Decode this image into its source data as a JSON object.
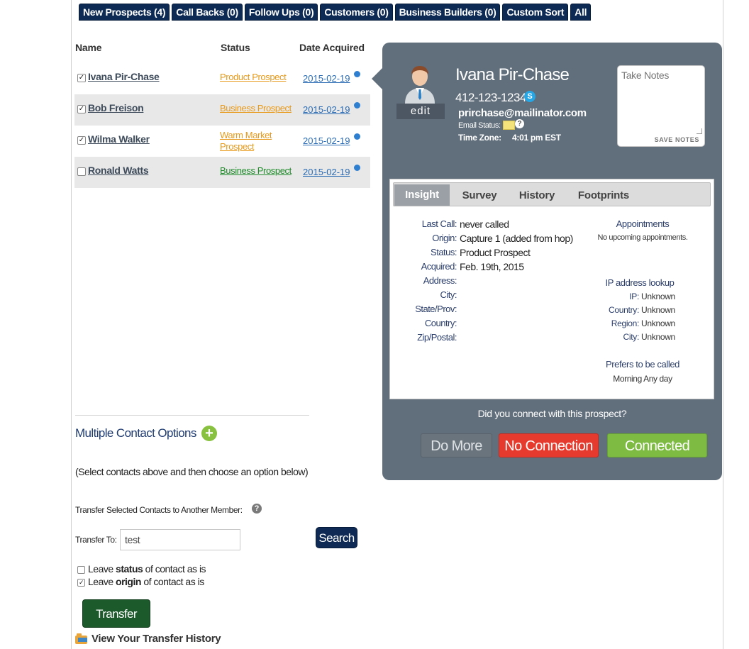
{
  "tabs": [
    {
      "label": "New Prospects (4)"
    },
    {
      "label": "Call Backs (0)"
    },
    {
      "label": "Follow Ups (0)"
    },
    {
      "label": "Customers (0)"
    },
    {
      "label": "Business Builders (0)"
    },
    {
      "label": "Custom Sort"
    },
    {
      "label": "All"
    }
  ],
  "table": {
    "headers": {
      "name": "Name",
      "status": "Status",
      "date": "Date Acquired"
    },
    "rows": [
      {
        "name": "Ivana Pir-Chase",
        "status": "Product Prospect",
        "status_color": "#e79a1b",
        "date": "2015-02-19",
        "checked": true
      },
      {
        "name": "Bob Freison",
        "status": "Business Prospect",
        "status_color": "#e79a1b",
        "date": "2015-02-19",
        "checked": true
      },
      {
        "name": "Wilma Walker",
        "status": "Warm Market Prospect",
        "status_line1": "Warm Market",
        "status_line2": "Prospect",
        "status_color": "#e79a1b",
        "date": "2015-02-19",
        "checked": true
      },
      {
        "name": "Ronald Watts",
        "status": "Business Prospect",
        "status_color": "#1f8a2a",
        "date": "2015-02-19",
        "checked": false
      }
    ]
  },
  "contact": {
    "edit_label": "edit",
    "name": "Ivana Pir-Chase",
    "phone": "412-123-1234",
    "email": "prirchase@mailinator.com",
    "email_status_label": "Email Status:",
    "timezone_label": "Time Zone:",
    "timezone_value": "4:01 pm EST",
    "notes_placeholder": "Take Notes",
    "save_notes_label": "SAVE NOTES"
  },
  "info_tabs": [
    {
      "label": "Insight",
      "active": true
    },
    {
      "label": "Survey",
      "active": false
    },
    {
      "label": "History",
      "active": false
    },
    {
      "label": "Footprints",
      "active": false
    }
  ],
  "insight": {
    "fields": [
      {
        "label": "Last Call:",
        "value": "never called"
      },
      {
        "label": "Origin:",
        "value": "Capture 1 (added from hop)"
      },
      {
        "label": "Status:",
        "value": "Product Prospect"
      },
      {
        "label": "Acquired:",
        "value": "Feb. 19th, 2015"
      },
      {
        "label": "Address:",
        "value": ""
      },
      {
        "label": "City:",
        "value": ""
      },
      {
        "label": "State/Prov:",
        "value": ""
      },
      {
        "label": "Country:",
        "value": ""
      },
      {
        "label": "Zip/Postal:",
        "value": ""
      }
    ],
    "appointments_title": "Appointments",
    "appointments_text": "No upcoming appointments.",
    "ip_title": "IP address lookup",
    "ip_fields": [
      {
        "label": "IP:",
        "value": "Unknown"
      },
      {
        "label": "Country:",
        "value": "Unknown"
      },
      {
        "label": "Region:",
        "value": "Unknown"
      },
      {
        "label": "City:",
        "value": "Unknown"
      }
    ],
    "prefers_title": "Prefers to be called",
    "prefers_text": "Morning Any day"
  },
  "connect": {
    "question": "Did you connect with this prospect?",
    "do_more": "Do More",
    "no_connection": "No Connection",
    "connected": "Connected"
  },
  "multi": {
    "title": "Multiple Contact Options",
    "instructions": "(Select contacts above and then choose an option below)",
    "transfer_label": "Transfer Selected Contacts to Another Member:",
    "transfer_to_label": "Transfer To:",
    "transfer_to_value": "test",
    "search_label": "Search",
    "leave_status": {
      "pre": "Leave ",
      "bold": "status",
      "post": " of contact as is",
      "checked": false
    },
    "leave_origin": {
      "pre": "Leave ",
      "bold": "origin",
      "post": " of contact as is",
      "checked": true
    },
    "transfer_button": "Transfer",
    "history_link": "View Your Transfer History"
  },
  "colors": {
    "tab_bg": "#0d2a55",
    "panel_bg": "#616e7b",
    "no_connection": "#e53a2d",
    "connected": "#7dbb43",
    "transfer_btn": "#1d5a2b"
  }
}
